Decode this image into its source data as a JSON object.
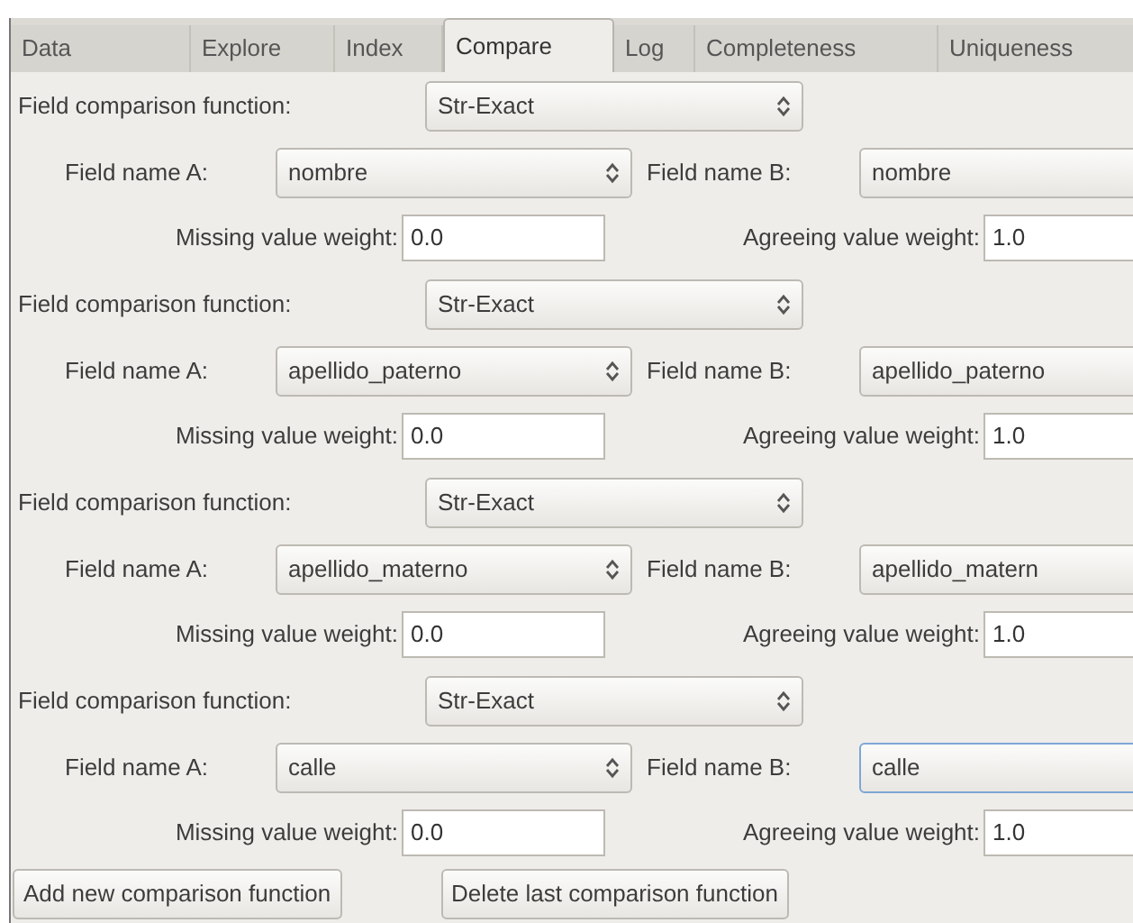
{
  "tabs": [
    {
      "label": "Data",
      "selected": false
    },
    {
      "label": "Explore",
      "selected": false
    },
    {
      "label": "Index",
      "selected": false
    },
    {
      "label": "Compare",
      "selected": true
    },
    {
      "label": "Log",
      "selected": false
    },
    {
      "label": "Completeness",
      "selected": false
    },
    {
      "label": "Uniqueness",
      "selected": false
    }
  ],
  "comparisons": [
    {
      "function_label": "Field comparison function:",
      "function": "Str-Exact",
      "field_a_label": "Field name A:",
      "field_a": "nombre",
      "field_b_label": "Field name B:",
      "field_b": "nombre",
      "field_b_focused": false,
      "missing_label": "Missing value weight:",
      "missing_weight": "0.0",
      "agreeing_label": "Agreeing value weight:",
      "agreeing_weight": "1.0"
    },
    {
      "function_label": "Field comparison function:",
      "function": "Str-Exact",
      "field_a_label": "Field name A:",
      "field_a": "apellido_paterno",
      "field_b_label": "Field name B:",
      "field_b": "apellido_paterno",
      "field_b_focused": false,
      "missing_label": "Missing value weight:",
      "missing_weight": "0.0",
      "agreeing_label": "Agreeing value weight:",
      "agreeing_weight": "1.0"
    },
    {
      "function_label": "Field comparison function:",
      "function": "Str-Exact",
      "field_a_label": "Field name A:",
      "field_a": "apellido_materno",
      "field_b_label": "Field name B:",
      "field_b": "apellido_matern",
      "field_b_focused": false,
      "missing_label": "Missing value weight:",
      "missing_weight": "0.0",
      "agreeing_label": "Agreeing value weight:",
      "agreeing_weight": "1.0"
    },
    {
      "function_label": "Field comparison function:",
      "function": "Str-Exact",
      "field_a_label": "Field name A:",
      "field_a": "calle",
      "field_b_label": "Field name B:",
      "field_b": "calle",
      "field_b_focused": true,
      "missing_label": "Missing value weight:",
      "missing_weight": "0.0",
      "agreeing_label": "Agreeing value weight:",
      "agreeing_weight": "1.0"
    }
  ],
  "buttons": [
    "Add new comparison function",
    "Delete last comparison function"
  ]
}
